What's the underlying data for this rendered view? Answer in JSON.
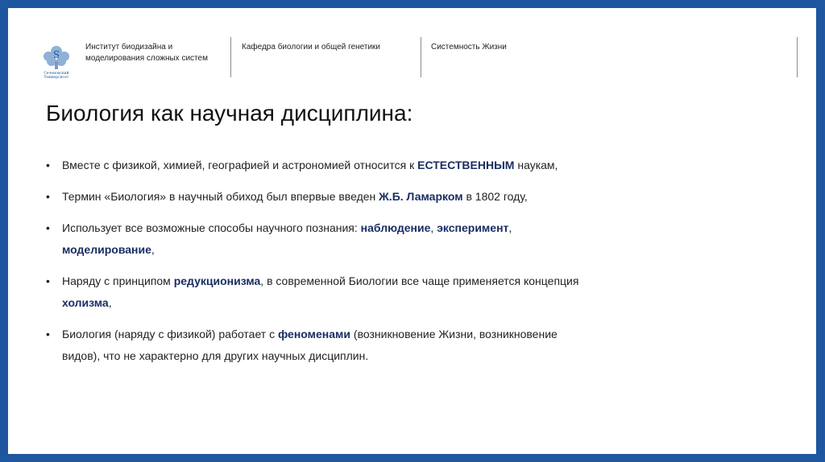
{
  "header": {
    "institute_line1": "Институт биодизайна и",
    "institute_line2": "моделирования сложных систем",
    "department": "Кафедра биологии и общей генетики",
    "section": "Системность Жизни",
    "logo_text_line1": "Сеченовский",
    "logo_text_line2": "Университет"
  },
  "slide": {
    "title": "Биология как научная дисциплина:",
    "bullet_glyph": "•",
    "b1": {
      "t1": "Вместе с физикой, химией, географией и астрономией относится к ",
      "h1": "ЕСТЕСТВЕННЫМ",
      "t2": " наукам,"
    },
    "b2": {
      "t1": "Термин «Биология» в научный обиход был впервые введен ",
      "h1": "Ж.Б. Ламарком",
      "t2": " в 1802 году,"
    },
    "b3": {
      "t1": "Использует  все возможные способы научного познания: ",
      "h1": "наблюдение",
      "t2": ", ",
      "h2": "эксперимент",
      "t3": ", ",
      "h3": "моделирование",
      "t4": ","
    },
    "b4": {
      "t1": "Наряду с принципом ",
      "h1": "редукционизма",
      "t2": ", в современной Биологии все чаще применяется концепция ",
      "h2": "холизма",
      "t3": ","
    },
    "b5": {
      "t1": "Биология (наряду с физикой) работает с ",
      "h1": "феноменами",
      "t2": " (возникновение Жизни, возникновение видов), что не характерно для других научных дисциплин."
    }
  },
  "colors": {
    "frame": "#1e56a0",
    "highlight": "#1a2e63",
    "text": "#222222"
  }
}
